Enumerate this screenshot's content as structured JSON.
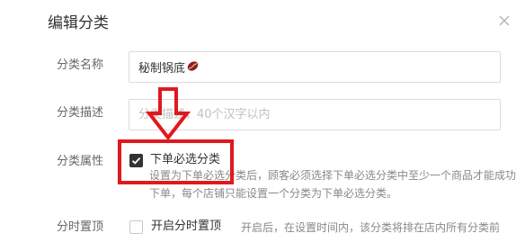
{
  "dialog": {
    "title": "编辑分类"
  },
  "fields": {
    "name_label": "分类名称",
    "name_value": "秘制锅底",
    "desc_label": "分类描述",
    "desc_placeholder": "分类描述，40个汉字以内",
    "attr_label": "分类属性",
    "attr_checkbox_label": "下单必选分类",
    "attr_checked": true,
    "attr_hint_line1": "设置为下单必选分类后，顾客必须选择下单必选分类中至少一个商品才能成功",
    "attr_hint_line2": "下单，每个店铺只能设置一个分类为下单必选分类。",
    "pin_label": "分时置顶",
    "pin_checkbox_label": "开启分时置顶",
    "pin_checked": false,
    "pin_hint": "开启后，在设置时间内，该分类将排在店内所有分类前"
  },
  "icons": {
    "close": "close-icon",
    "bean": "coffee-bean-emoji-icon",
    "check": "check-icon"
  },
  "colors": {
    "annotation": "#e0191e",
    "checkbox_checked": "#333333"
  }
}
